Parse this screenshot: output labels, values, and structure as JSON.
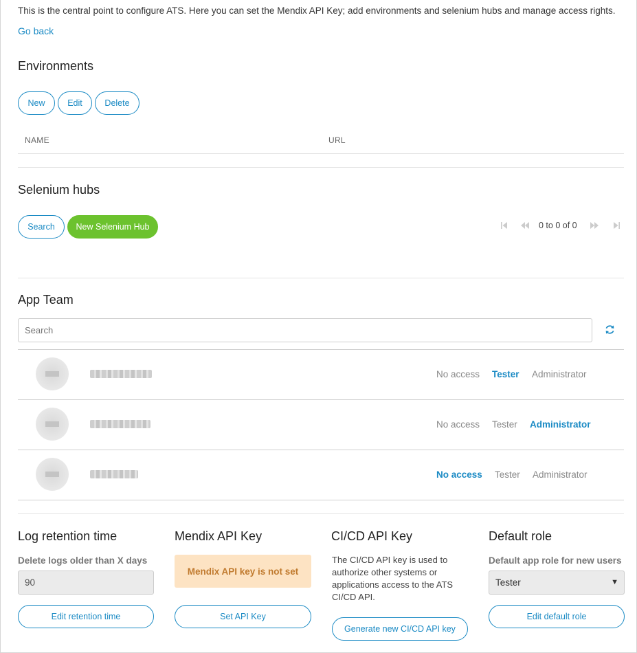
{
  "intro": "This is the central point to configure ATS. Here you can set the Mendix API Key; add environments and selenium hubs and manage access rights.",
  "go_back": "Go back",
  "environments": {
    "title": "Environments",
    "buttons": {
      "new": "New",
      "edit": "Edit",
      "delete": "Delete"
    },
    "columns": {
      "name": "NAME",
      "url": "URL"
    }
  },
  "selenium": {
    "title": "Selenium hubs",
    "buttons": {
      "search": "Search",
      "new": "New Selenium Hub"
    },
    "pagination": "0 to 0 of 0"
  },
  "app_team": {
    "title": "App Team",
    "search_placeholder": "Search",
    "roles": [
      "No access",
      "Tester",
      "Administrator"
    ],
    "members": [
      {
        "active_role": "Tester"
      },
      {
        "active_role": "Administrator"
      },
      {
        "active_role": "No access"
      }
    ]
  },
  "log_retention": {
    "title": "Log retention time",
    "label": "Delete logs older than X days",
    "value": "90",
    "button": "Edit retention time"
  },
  "mendix_api": {
    "title": "Mendix API Key",
    "status": "Mendix API key is not set",
    "button": "Set API Key"
  },
  "cicd_api": {
    "title": "CI/CD API Key",
    "description": "The CI/CD API key is used to authorize other systems or applications access to the ATS CI/CD API.",
    "button": "Generate new CI/CD API key"
  },
  "default_role": {
    "title": "Default role",
    "label": "Default app role for new users",
    "value": "Tester",
    "button": "Edit default role"
  },
  "colors": {
    "accent": "#1a8ac4",
    "green": "#6cc22e",
    "warning_bg": "#fde3c3",
    "warning_text": "#c07a2e"
  },
  "icons": {
    "refresh": "refresh-icon",
    "first": "first-page-icon",
    "prev": "prev-page-icon",
    "next": "next-page-icon",
    "last": "last-page-icon",
    "dropdown": "caret-down-icon"
  }
}
